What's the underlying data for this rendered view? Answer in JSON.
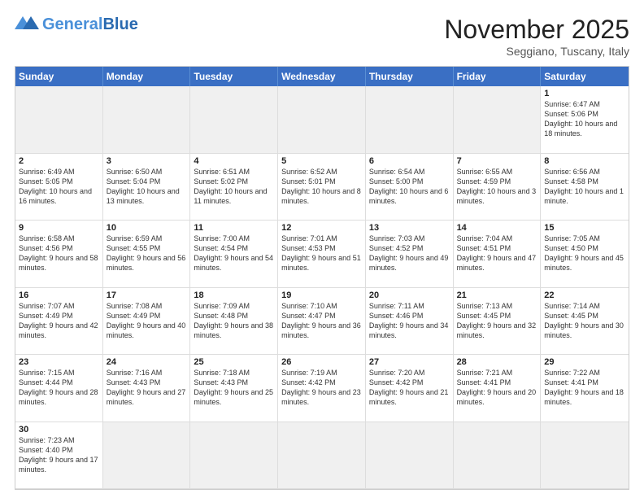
{
  "header": {
    "logo_general": "General",
    "logo_blue": "Blue",
    "month_title": "November 2025",
    "location": "Seggiano, Tuscany, Italy"
  },
  "weekdays": [
    "Sunday",
    "Monday",
    "Tuesday",
    "Wednesday",
    "Thursday",
    "Friday",
    "Saturday"
  ],
  "days": [
    {
      "num": "",
      "info": "",
      "empty": true
    },
    {
      "num": "",
      "info": "",
      "empty": true
    },
    {
      "num": "",
      "info": "",
      "empty": true
    },
    {
      "num": "",
      "info": "",
      "empty": true
    },
    {
      "num": "",
      "info": "",
      "empty": true
    },
    {
      "num": "",
      "info": "",
      "empty": true
    },
    {
      "num": "1",
      "info": "Sunrise: 6:47 AM\nSunset: 5:06 PM\nDaylight: 10 hours and 18 minutes."
    },
    {
      "num": "2",
      "info": "Sunrise: 6:49 AM\nSunset: 5:05 PM\nDaylight: 10 hours and 16 minutes."
    },
    {
      "num": "3",
      "info": "Sunrise: 6:50 AM\nSunset: 5:04 PM\nDaylight: 10 hours and 13 minutes."
    },
    {
      "num": "4",
      "info": "Sunrise: 6:51 AM\nSunset: 5:02 PM\nDaylight: 10 hours and 11 minutes."
    },
    {
      "num": "5",
      "info": "Sunrise: 6:52 AM\nSunset: 5:01 PM\nDaylight: 10 hours and 8 minutes."
    },
    {
      "num": "6",
      "info": "Sunrise: 6:54 AM\nSunset: 5:00 PM\nDaylight: 10 hours and 6 minutes."
    },
    {
      "num": "7",
      "info": "Sunrise: 6:55 AM\nSunset: 4:59 PM\nDaylight: 10 hours and 3 minutes."
    },
    {
      "num": "8",
      "info": "Sunrise: 6:56 AM\nSunset: 4:58 PM\nDaylight: 10 hours and 1 minute."
    },
    {
      "num": "9",
      "info": "Sunrise: 6:58 AM\nSunset: 4:56 PM\nDaylight: 9 hours and 58 minutes."
    },
    {
      "num": "10",
      "info": "Sunrise: 6:59 AM\nSunset: 4:55 PM\nDaylight: 9 hours and 56 minutes."
    },
    {
      "num": "11",
      "info": "Sunrise: 7:00 AM\nSunset: 4:54 PM\nDaylight: 9 hours and 54 minutes."
    },
    {
      "num": "12",
      "info": "Sunrise: 7:01 AM\nSunset: 4:53 PM\nDaylight: 9 hours and 51 minutes."
    },
    {
      "num": "13",
      "info": "Sunrise: 7:03 AM\nSunset: 4:52 PM\nDaylight: 9 hours and 49 minutes."
    },
    {
      "num": "14",
      "info": "Sunrise: 7:04 AM\nSunset: 4:51 PM\nDaylight: 9 hours and 47 minutes."
    },
    {
      "num": "15",
      "info": "Sunrise: 7:05 AM\nSunset: 4:50 PM\nDaylight: 9 hours and 45 minutes."
    },
    {
      "num": "16",
      "info": "Sunrise: 7:07 AM\nSunset: 4:49 PM\nDaylight: 9 hours and 42 minutes."
    },
    {
      "num": "17",
      "info": "Sunrise: 7:08 AM\nSunset: 4:49 PM\nDaylight: 9 hours and 40 minutes."
    },
    {
      "num": "18",
      "info": "Sunrise: 7:09 AM\nSunset: 4:48 PM\nDaylight: 9 hours and 38 minutes."
    },
    {
      "num": "19",
      "info": "Sunrise: 7:10 AM\nSunset: 4:47 PM\nDaylight: 9 hours and 36 minutes."
    },
    {
      "num": "20",
      "info": "Sunrise: 7:11 AM\nSunset: 4:46 PM\nDaylight: 9 hours and 34 minutes."
    },
    {
      "num": "21",
      "info": "Sunrise: 7:13 AM\nSunset: 4:45 PM\nDaylight: 9 hours and 32 minutes."
    },
    {
      "num": "22",
      "info": "Sunrise: 7:14 AM\nSunset: 4:45 PM\nDaylight: 9 hours and 30 minutes."
    },
    {
      "num": "23",
      "info": "Sunrise: 7:15 AM\nSunset: 4:44 PM\nDaylight: 9 hours and 28 minutes."
    },
    {
      "num": "24",
      "info": "Sunrise: 7:16 AM\nSunset: 4:43 PM\nDaylight: 9 hours and 27 minutes."
    },
    {
      "num": "25",
      "info": "Sunrise: 7:18 AM\nSunset: 4:43 PM\nDaylight: 9 hours and 25 minutes."
    },
    {
      "num": "26",
      "info": "Sunrise: 7:19 AM\nSunset: 4:42 PM\nDaylight: 9 hours and 23 minutes."
    },
    {
      "num": "27",
      "info": "Sunrise: 7:20 AM\nSunset: 4:42 PM\nDaylight: 9 hours and 21 minutes."
    },
    {
      "num": "28",
      "info": "Sunrise: 7:21 AM\nSunset: 4:41 PM\nDaylight: 9 hours and 20 minutes."
    },
    {
      "num": "29",
      "info": "Sunrise: 7:22 AM\nSunset: 4:41 PM\nDaylight: 9 hours and 18 minutes."
    },
    {
      "num": "30",
      "info": "Sunrise: 7:23 AM\nSunset: 4:40 PM\nDaylight: 9 hours and 17 minutes."
    },
    {
      "num": "",
      "info": "",
      "empty": true
    },
    {
      "num": "",
      "info": "",
      "empty": true
    },
    {
      "num": "",
      "info": "",
      "empty": true
    },
    {
      "num": "",
      "info": "",
      "empty": true
    },
    {
      "num": "",
      "info": "",
      "empty": true
    },
    {
      "num": "",
      "info": "",
      "empty": true
    }
  ]
}
